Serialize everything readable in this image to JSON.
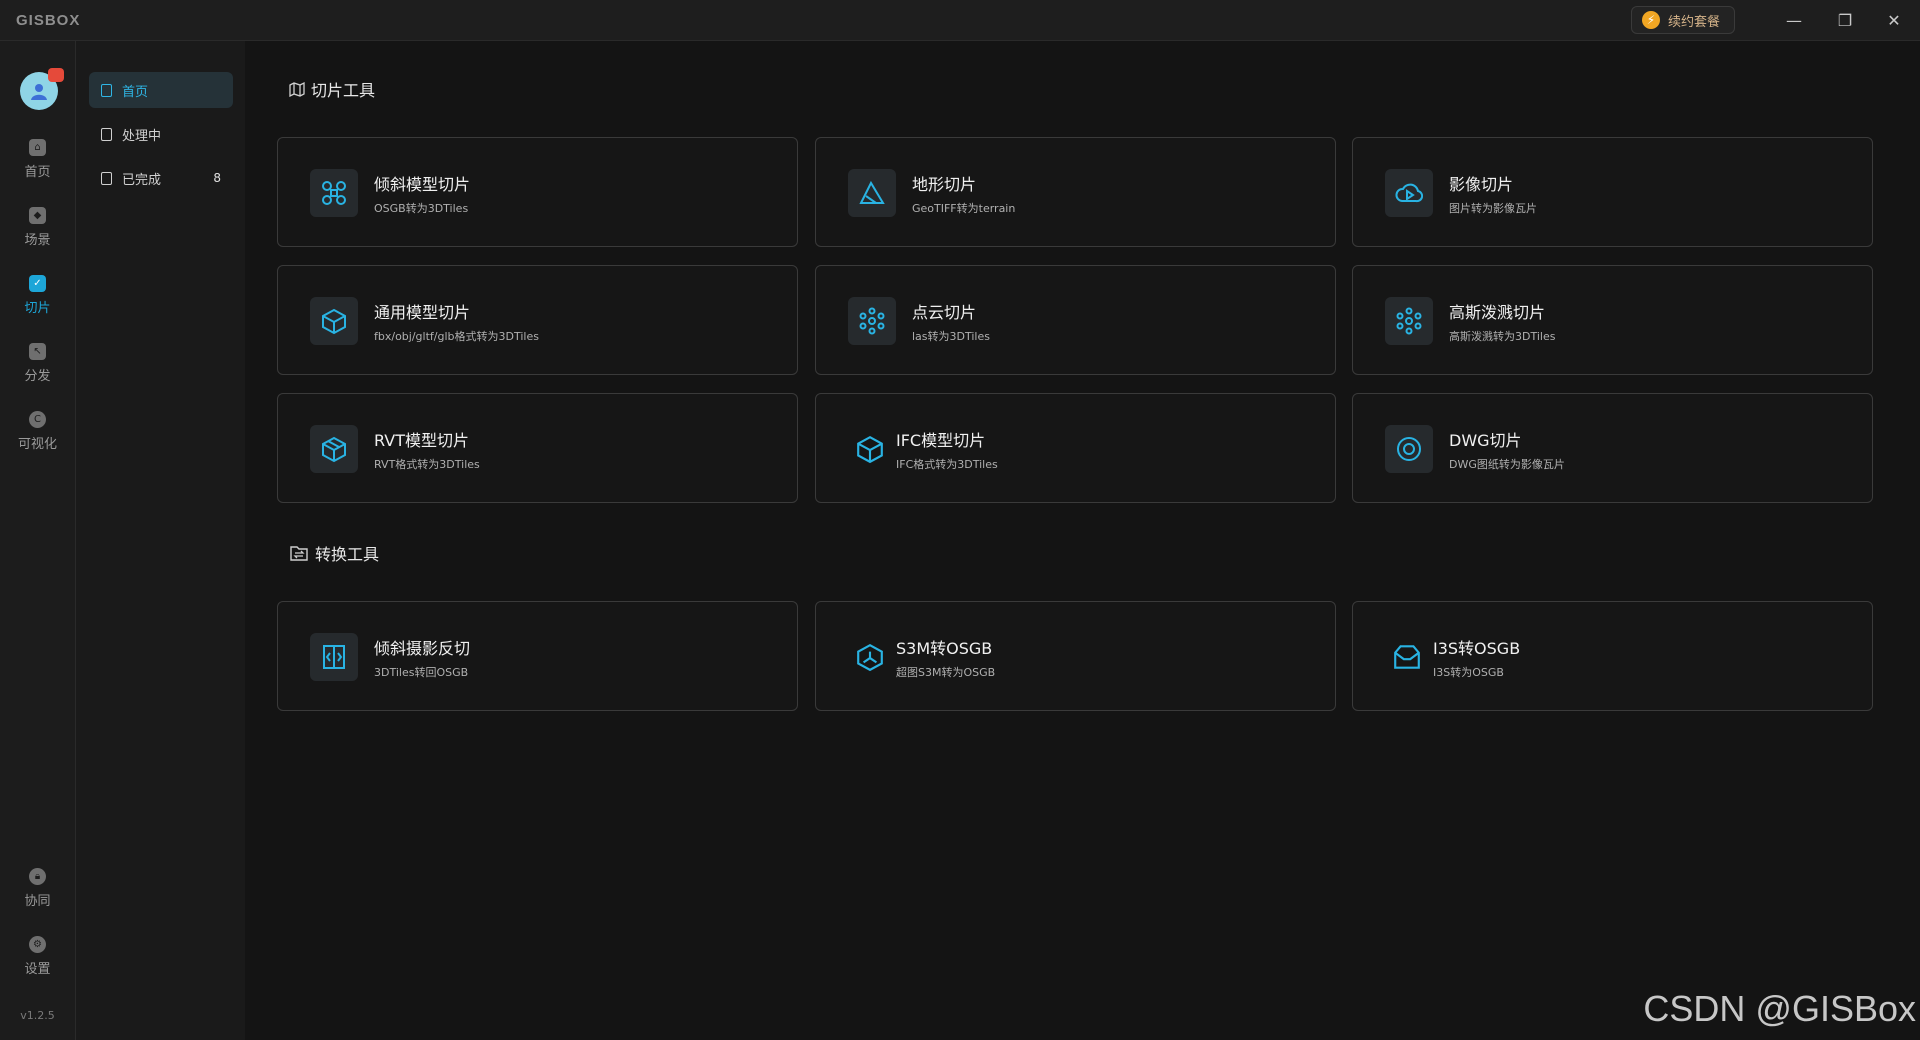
{
  "app": {
    "logo": "GISBOX"
  },
  "titlebar": {
    "renew_label": "续约套餐",
    "minimize": "—",
    "restore": "❐",
    "close": "✕"
  },
  "rail": {
    "items": [
      {
        "label": "首页",
        "icon": "home-icon"
      },
      {
        "label": "场景",
        "icon": "scene-icon"
      },
      {
        "label": "切片",
        "icon": "slice-icon",
        "active": true
      },
      {
        "label": "分发",
        "icon": "distribute-icon"
      },
      {
        "label": "可视化",
        "icon": "visualize-icon"
      },
      {
        "label": "协同",
        "icon": "collab-icon"
      },
      {
        "label": "设置",
        "icon": "settings-icon"
      }
    ],
    "version": "v1.2.5"
  },
  "subnav": {
    "items": [
      {
        "label": "首页",
        "active": true
      },
      {
        "label": "处理中"
      },
      {
        "label": "已完成",
        "count": "8"
      }
    ]
  },
  "sections": {
    "slice": {
      "title": "切片工具",
      "cards": [
        {
          "title": "倾斜模型切片",
          "desc": "OSGB转为3DTiles",
          "icon": "drone-icon"
        },
        {
          "title": "地形切片",
          "desc": "GeoTIFF转为terrain",
          "icon": "terrain-icon"
        },
        {
          "title": "影像切片",
          "desc": "图片转为影像瓦片",
          "icon": "cloud-image-icon"
        },
        {
          "title": "通用模型切片",
          "desc": "fbx/obj/gltf/glb格式转为3DTiles",
          "icon": "box-icon"
        },
        {
          "title": "点云切片",
          "desc": "las转为3DTiles",
          "icon": "pointcloud-icon"
        },
        {
          "title": "高斯泼溅切片",
          "desc": "高斯泼溅转为3DTiles",
          "icon": "gaussian-icon"
        },
        {
          "title": "RVT模型切片",
          "desc": "RVT格式转为3DTiles",
          "icon": "rvt-icon"
        },
        {
          "title": "IFC模型切片",
          "desc": "IFC格式转为3DTiles",
          "icon": "ifc-icon"
        },
        {
          "title": "DWG切片",
          "desc": "DWG图纸转为影像瓦片",
          "icon": "dwg-icon"
        }
      ]
    },
    "convert": {
      "title": "转换工具",
      "cards": [
        {
          "title": "倾斜摄影反切",
          "desc": "3DTiles转回OSGB",
          "icon": "reverse-icon"
        },
        {
          "title": "S3M转OSGB",
          "desc": "超图S3M转为OSGB",
          "icon": "s3m-icon"
        },
        {
          "title": "I3S转OSGB",
          "desc": "I3S转为OSGB",
          "icon": "i3s-icon"
        }
      ]
    }
  },
  "watermark": "CSDN @GISBox",
  "colors": {
    "accent": "#1da6d8",
    "background": "#141414",
    "card_border": "#3a3a3a"
  }
}
